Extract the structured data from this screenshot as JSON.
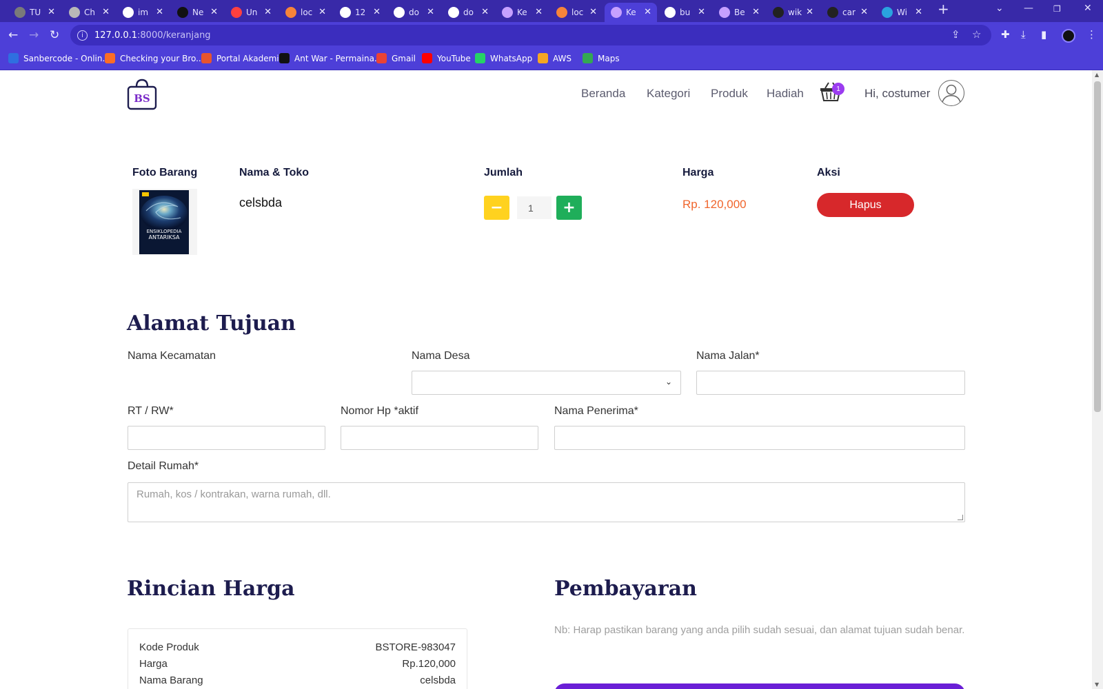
{
  "browser": {
    "tabs": [
      {
        "label": "TU",
        "favicon": "gray-globe",
        "color": "#7a7a7a"
      },
      {
        "label": "Ch",
        "favicon": "openai-icon",
        "color": "#b8b8b8"
      },
      {
        "label": "im",
        "favicon": "google-icon",
        "color": "#ffffff"
      },
      {
        "label": "Ne",
        "favicon": "medium-icon",
        "color": "#111111"
      },
      {
        "label": "Un",
        "favicon": "link-icon",
        "color": "#ff4040"
      },
      {
        "label": "loc",
        "favicon": "laravel-icon",
        "color": "#f7843a"
      },
      {
        "label": "12",
        "favicon": "page-icon",
        "color": "#ffffff"
      },
      {
        "label": "do",
        "favicon": "google-icon",
        "color": "#ffffff"
      },
      {
        "label": "do",
        "favicon": "google-icon",
        "color": "#ffffff"
      },
      {
        "label": "Ke",
        "favicon": "bag-icon",
        "color": "#c6a0ff"
      },
      {
        "label": "loc",
        "favicon": "laravel-icon",
        "color": "#f7843a"
      },
      {
        "label": "Ke",
        "favicon": "bag-icon",
        "color": "#c6a0ff",
        "active": true
      },
      {
        "label": "bu",
        "favicon": "google-icon",
        "color": "#ffffff"
      },
      {
        "label": "Be",
        "favicon": "bag-icon",
        "color": "#c6a0ff"
      },
      {
        "label": "wik",
        "favicon": "github-icon",
        "color": "#222222"
      },
      {
        "label": "car",
        "favicon": "github-icon",
        "color": "#222222"
      },
      {
        "label": "Wi",
        "favicon": "telegram-icon",
        "color": "#2aa3df"
      }
    ],
    "url_host": "127.0.0.1",
    "url_path": ":8000/keranjang",
    "bookmarks": [
      {
        "label": "Sanbercode - Onlin...",
        "color": "#2f6fe0"
      },
      {
        "label": "Checking your Bro...",
        "color": "#fc6d26"
      },
      {
        "label": "Portal Akademik",
        "color": "#e8542d"
      },
      {
        "label": "Ant War - Permaina...",
        "color": "#111111"
      },
      {
        "label": "Gmail",
        "color": "#ea4335"
      },
      {
        "label": "YouTube",
        "color": "#ff0000"
      },
      {
        "label": "WhatsApp",
        "color": "#25d366"
      },
      {
        "label": "AWS",
        "color": "#f5a623"
      },
      {
        "label": "Maps",
        "color": "#34a853"
      }
    ]
  },
  "site": {
    "logo_text": "BS",
    "nav": [
      "Beranda",
      "Kategori",
      "Produk",
      "Hadiah"
    ],
    "cart_count": "1",
    "greeting": "Hi, costumer"
  },
  "cart": {
    "headers": {
      "photo": "Foto Barang",
      "name": "Nama & Toko",
      "qty": "Jumlah",
      "price": "Harga",
      "action": "Aksi"
    },
    "item": {
      "name": "celsbda",
      "qty": "1",
      "price": "Rp. 120,000",
      "action_label": "Hapus",
      "book_title_1": "ENSIKLOPEDIA",
      "book_title_2": "ANTARIKSA"
    }
  },
  "address": {
    "title": "Alamat Tujuan",
    "kecamatan_label": "Nama Kecamatan",
    "desa_label": "Nama Desa",
    "jalan_label": "Nama Jalan*",
    "rtrw_label": "RT / RW*",
    "hp_label": "Nomor Hp *aktif",
    "penerima_label": "Nama Penerima*",
    "detail_label": "Detail Rumah*",
    "detail_placeholder": "Rumah, kos / kontrakan, warna rumah, dll."
  },
  "summary": {
    "title": "Rincian Harga",
    "rows": [
      {
        "key": "Kode Produk",
        "value": "BSTORE-983047"
      },
      {
        "key": "Harga",
        "value": "Rp.120,000"
      },
      {
        "key": "Nama Barang",
        "value": "celsbda"
      }
    ]
  },
  "payment": {
    "title": "Pembayaran",
    "note": "Nb: Harap pastikan barang yang anda pilih sudah sesuai, dan alamat tujuan sudah benar."
  }
}
